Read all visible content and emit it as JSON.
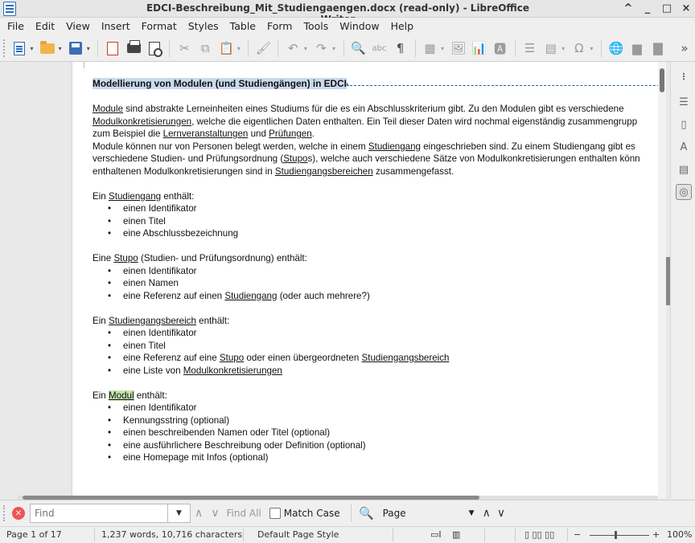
{
  "window": {
    "title": "EDCI-Beschreibung_Mit_Studiengaengen.docx (read-only) - LibreOffice Writer",
    "controls": [
      "^",
      "_",
      "□",
      "×"
    ]
  },
  "menubar": [
    "File",
    "Edit",
    "View",
    "Insert",
    "Format",
    "Styles",
    "Table",
    "Form",
    "Tools",
    "Window",
    "Help"
  ],
  "toolbar": {
    "overflow": "»"
  },
  "document": {
    "heading": "Modellierung von Modulen (und Studiengängen) in EDCI",
    "intro": {
      "l1": {
        "a": "Module",
        "b": " sind abstrakte Lerneinheiten eines Studiums für die es ein Abschlusskriterium gibt. Zu den Modulen gibt es verschiedene"
      },
      "l2": {
        "a": "Modulkonkretisierungen",
        "b": ", welche die eigentlichen Daten enthalten. Ein Teil dieser Daten wird nochmal eigenständig zusammengrupp"
      },
      "l3": {
        "a": "zum Beispiel die ",
        "b": "Lernveranstaltungen",
        "c": " und ",
        "d": "Prüfungen",
        "e": "."
      },
      "l4": {
        "a": "Module können nur von Personen belegt werden, welche in einem ",
        "b": "Studiengang",
        "c": " eingeschrieben sind. Zu einem Studiengang gibt es"
      },
      "l5": {
        "a": "verschiedene Studien- und Prüfungsordnung (",
        "b": "Stupo",
        "c": "s), welche auch verschiedene Sätze von Modulkonkretisierungen enthalten könn"
      },
      "l6": {
        "a": "enthaltenen Modulkonkretisierungen sind in ",
        "b": "Studiengangsbereichen",
        "c": " zusammengefasst."
      }
    },
    "studiengang": {
      "pre": "Ein ",
      "link": "Studiengang",
      "post": " enthält:",
      "items": [
        "einen Identifikator",
        "einen Titel",
        "eine Abschlussbezeichnung"
      ]
    },
    "stupo": {
      "pre": "Eine ",
      "link": "Stupo",
      "post": " (Studien- und Prüfungsordnung) enthält:",
      "items": [
        "einen Identifikator",
        "einen Namen"
      ],
      "item3": {
        "a": "eine Referenz auf einen ",
        "b": "Studiengang",
        "c": " (oder auch mehrere?)"
      }
    },
    "bereich": {
      "pre": "Ein ",
      "link": "Studiengangsbereich",
      "post": " enthält:",
      "items": [
        "einen Identifikator",
        "einen Titel"
      ],
      "item3": {
        "a": "eine Referenz auf eine ",
        "b": "Stupo",
        "c": " oder einen übergeordneten ",
        "d": "Studiengangsbereich"
      },
      "item4": {
        "a": "eine Liste von ",
        "b": "Modulkonkretisierungen"
      }
    },
    "modul": {
      "pre": "Ein ",
      "link": "Modul",
      "post": " enthält:",
      "items": [
        "einen Identifikator",
        "Kennungsstring (optional)",
        "einen beschreibenden Namen oder Titel (optional)",
        "eine ausführlichere Beschreibung oder Definition (optional)",
        "eine Homepage mit Infos (optional)"
      ]
    }
  },
  "findbar": {
    "placeholder": "Find",
    "find_all": "Find All",
    "match_case": "Match Case",
    "search_scope": "Page"
  },
  "statusbar": {
    "page": "Page 1 of 17",
    "words": "1,237 words, 10,716 characters",
    "page_style": "Default Page Style",
    "zoom": "100%"
  }
}
